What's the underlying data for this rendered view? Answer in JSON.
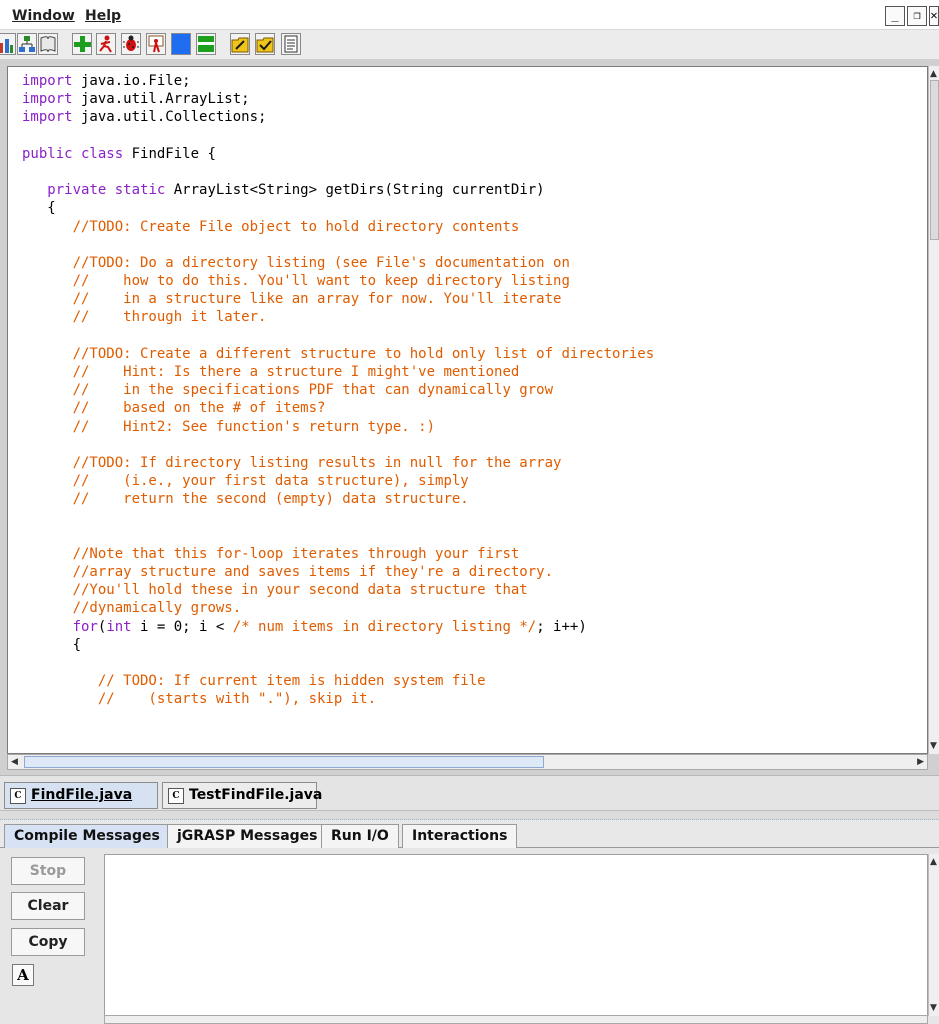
{
  "menu": {
    "items": [
      "Window",
      "Help"
    ]
  },
  "window_controls": {
    "minimize": "_",
    "restore": "❐",
    "close": "✕"
  },
  "toolbar": {
    "icons": [
      "bar-chart-icon",
      "tree-icon",
      "book-icon",
      "add-icon",
      "run-figure-icon",
      "debug-bug-icon",
      "run-presenter-icon",
      "blue-square-icon",
      "green-split-icon",
      "edit-folder-icon",
      "check-folder-icon",
      "document-icon"
    ]
  },
  "editor": {
    "file": "FindFile.java",
    "lines": [
      [
        [
          "kw",
          "import"
        ],
        [
          "t",
          " java.io.File;"
        ]
      ],
      [
        [
          "kw",
          "import"
        ],
        [
          "t",
          " java.util.ArrayList;"
        ]
      ],
      [
        [
          "kw",
          "import"
        ],
        [
          "t",
          " java.util.Collections;"
        ]
      ],
      [],
      [
        [
          "kw",
          "public class"
        ],
        [
          "t",
          " FindFile {"
        ]
      ],
      [],
      [
        [
          "t",
          "   "
        ],
        [
          "kw",
          "private static"
        ],
        [
          "t",
          " ArrayList<String> getDirs(String currentDir)"
        ]
      ],
      [
        [
          "t",
          "   {"
        ]
      ],
      [
        [
          "t",
          "      "
        ],
        [
          "cm",
          "//TODO: Create File object to hold directory contents"
        ]
      ],
      [],
      [
        [
          "t",
          "      "
        ],
        [
          "cm",
          "//TODO: Do a directory listing (see File's documentation on"
        ]
      ],
      [
        [
          "t",
          "      "
        ],
        [
          "cm",
          "//    how to do this. You'll want to keep directory listing"
        ]
      ],
      [
        [
          "t",
          "      "
        ],
        [
          "cm",
          "//    in a structure like an array for now. You'll iterate"
        ]
      ],
      [
        [
          "t",
          "      "
        ],
        [
          "cm",
          "//    through it later."
        ]
      ],
      [],
      [
        [
          "t",
          "      "
        ],
        [
          "cm",
          "//TODO: Create a different structure to hold only list of directories"
        ]
      ],
      [
        [
          "t",
          "      "
        ],
        [
          "cm",
          "//    Hint: Is there a structure I might've mentioned"
        ]
      ],
      [
        [
          "t",
          "      "
        ],
        [
          "cm",
          "//    in the specifications PDF that can dynamically grow"
        ]
      ],
      [
        [
          "t",
          "      "
        ],
        [
          "cm",
          "//    based on the # of items?"
        ]
      ],
      [
        [
          "t",
          "      "
        ],
        [
          "cm",
          "//    Hint2: See function's return type. :)"
        ]
      ],
      [],
      [
        [
          "t",
          "      "
        ],
        [
          "cm",
          "//TODO: If directory listing results in null for the array"
        ]
      ],
      [
        [
          "t",
          "      "
        ],
        [
          "cm",
          "//    (i.e., your first data structure), simply"
        ]
      ],
      [
        [
          "t",
          "      "
        ],
        [
          "cm",
          "//    return the second (empty) data structure."
        ]
      ],
      [],
      [],
      [
        [
          "t",
          "      "
        ],
        [
          "cm",
          "//Note that this for-loop iterates through your first"
        ]
      ],
      [
        [
          "t",
          "      "
        ],
        [
          "cm",
          "//array structure and saves items if they're a directory."
        ]
      ],
      [
        [
          "t",
          "      "
        ],
        [
          "cm",
          "//You'll hold these in your second data structure that"
        ]
      ],
      [
        [
          "t",
          "      "
        ],
        [
          "cm",
          "//dynamically grows."
        ]
      ],
      [
        [
          "t",
          "      "
        ],
        [
          "kw",
          "for"
        ],
        [
          "t",
          "("
        ],
        [
          "kw",
          "int"
        ],
        [
          "t",
          " i = 0; i < "
        ],
        [
          "cm",
          "/* num items in directory listing */"
        ],
        [
          "t",
          "; i++)"
        ]
      ],
      [
        [
          "t",
          "      {"
        ]
      ],
      [],
      [
        [
          "t",
          "         "
        ],
        [
          "cm",
          "// TODO: If current item is hidden system file"
        ]
      ],
      [
        [
          "t",
          "         "
        ],
        [
          "cm",
          "//    (starts with \".\"), skip it."
        ]
      ]
    ]
  },
  "file_tabs": [
    {
      "label": "FindFile.java",
      "active": true
    },
    {
      "label": "TestFindFile.java",
      "active": false
    }
  ],
  "message_tabs": [
    "Compile Messages",
    "jGRASP Messages",
    "Run I/O",
    "Interactions"
  ],
  "message_panel": {
    "stop_label": "Stop",
    "clear_label": "Clear",
    "copy_label": "Copy",
    "font_button_label": "A",
    "output_text": ""
  },
  "colors": {
    "keyword": "#8a22c8",
    "comment": "#e05c00",
    "active_tab": "#d7e3f4"
  }
}
